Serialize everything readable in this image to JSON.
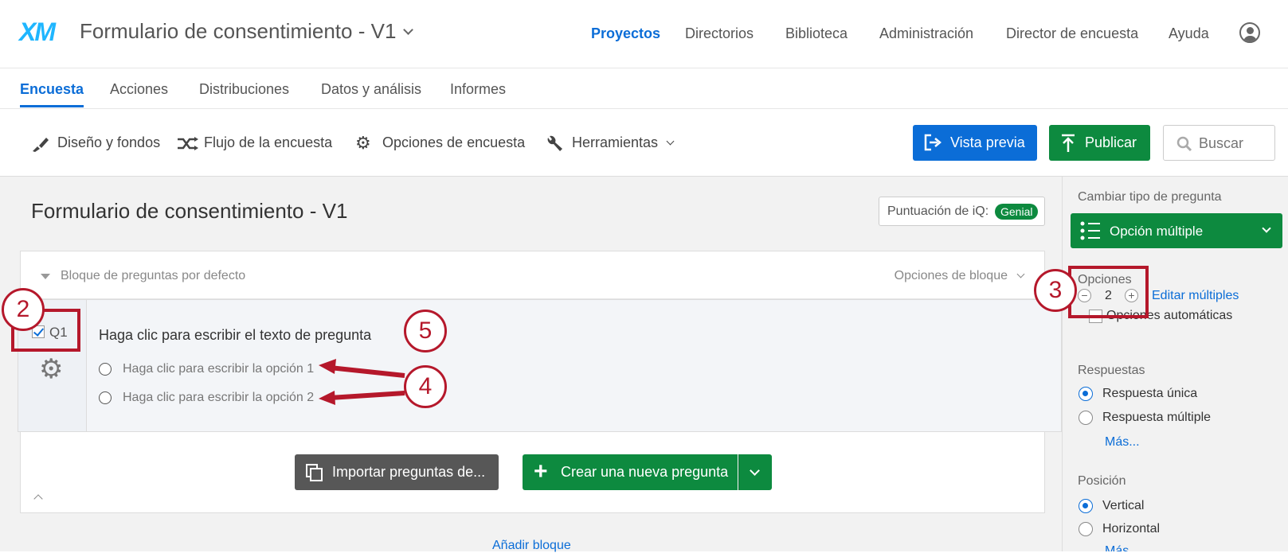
{
  "app": {
    "logo": "XM",
    "project_title": "Formulario de consentimiento - V1",
    "top_nav": [
      "Proyectos",
      "Directorios",
      "Biblioteca",
      "Administración",
      "Director de encuesta",
      "Ayuda"
    ]
  },
  "tabs": [
    "Encuesta",
    "Acciones",
    "Distribuciones",
    "Datos y análisis",
    "Informes"
  ],
  "toolbar": {
    "design": "Diseño y fondos",
    "flow": "Flujo de la encuesta",
    "options": "Opciones de encuesta",
    "tools": "Herramientas",
    "preview": "Vista previa",
    "publish": "Publicar",
    "search_placeholder": "Buscar"
  },
  "survey": {
    "title": "Formulario de consentimiento - V1",
    "iq_label": "Puntuación de iQ:",
    "iq_value": "Genial",
    "block_name": "Bloque de preguntas por defecto",
    "block_options": "Opciones de bloque",
    "question": {
      "number": "Q1",
      "text": "Haga clic para escribir el texto de pregunta",
      "options": [
        "Haga clic para escribir la opción 1",
        "Haga clic para escribir la opción 2"
      ]
    },
    "import_button": "Importar preguntas de...",
    "new_question_button": "Crear una nueva pregunta",
    "add_block": "Añadir bloque"
  },
  "sidebar": {
    "change_type_label": "Cambiar tipo de pregunta",
    "question_type": "Opción múltiple",
    "choices_label": "Opciones",
    "choices_count": "2",
    "edit_multiple": "Editar múltiples",
    "auto_choices": "Opciones automáticas",
    "answers_label": "Respuestas",
    "answers": [
      "Respuesta única",
      "Respuesta múltiple"
    ],
    "more": "Más...",
    "position_label": "Posición",
    "positions": [
      "Vertical",
      "Horizontal"
    ]
  },
  "callouts": [
    "2",
    "3",
    "4",
    "5"
  ],
  "colors": {
    "accent": "#0b6dd7",
    "green": "#0d8a3f",
    "annotation": "#b5182b"
  }
}
